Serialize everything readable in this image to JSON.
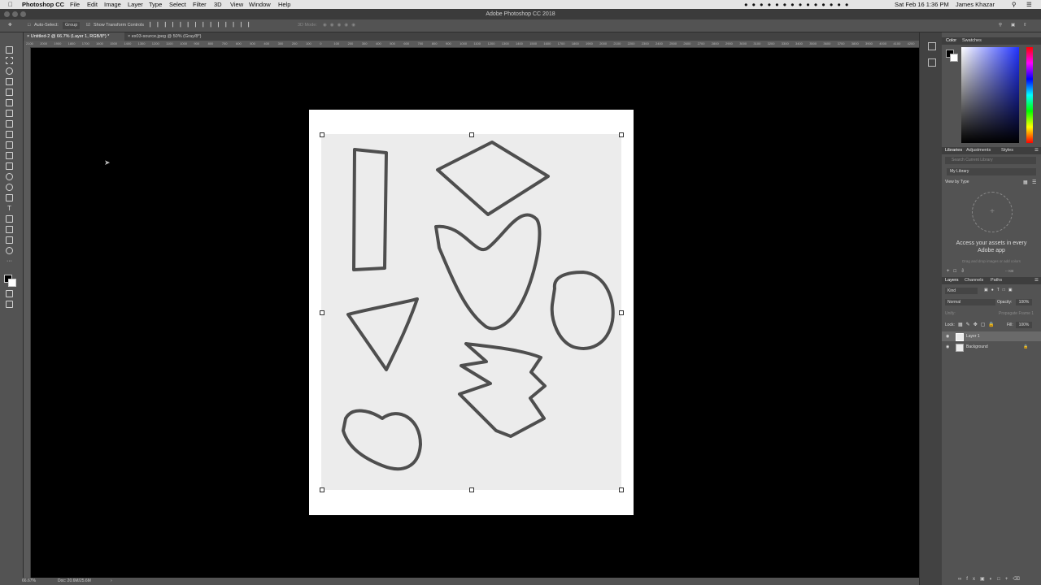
{
  "menubar": {
    "app": "Photoshop CC",
    "items": [
      "File",
      "Edit",
      "Image",
      "Layer",
      "Type",
      "Select",
      "Filter",
      "3D",
      "View",
      "Window",
      "Help"
    ],
    "datetime": "Sat Feb 16  1:36 PM",
    "user": "James Khazar"
  },
  "window": {
    "title": "Adobe Photoshop CC 2018"
  },
  "options": {
    "auto_select": "Auto-Select:",
    "group": "Group",
    "show_transform": "Show Transform Controls",
    "mode_3d": "3D Mode:"
  },
  "tabs": [
    {
      "label": "Untitled-2 @ 66.7% (Layer 1, RGB/8*) *"
    },
    {
      "label": "ex03-source.jpeg @ 50% (Gray/8*)"
    }
  ],
  "ruler": {
    "ticks": [
      "2100",
      "2000",
      "1900",
      "1800",
      "1700",
      "1600",
      "1500",
      "1400",
      "1300",
      "1200",
      "1100",
      "1000",
      "900",
      "800",
      "700",
      "600",
      "500",
      "400",
      "300",
      "200",
      "100",
      "0",
      "100",
      "200",
      "300",
      "400",
      "500",
      "600",
      "700",
      "800",
      "900",
      "1000",
      "1100",
      "1200",
      "1300",
      "1400",
      "1500",
      "1600",
      "1700",
      "1800",
      "1900",
      "2000",
      "2100",
      "2200",
      "2300",
      "2400",
      "2500",
      "2600",
      "2700",
      "2800",
      "2900",
      "3000",
      "3100",
      "3200",
      "3300",
      "3400",
      "3500",
      "3600",
      "3700",
      "3800",
      "3900",
      "4000",
      "4100",
      "4200"
    ]
  },
  "status": {
    "zoom": "66.67%",
    "doc": "Doc: 20.6M/25.6M"
  },
  "color_panel": {
    "tabs": [
      "Color",
      "Swatches"
    ]
  },
  "libraries": {
    "tabs": [
      "Libraries",
      "Adjustments",
      "Styles"
    ],
    "search_placeholder": "Search Current Library",
    "library": "My Library",
    "view_by": "View by Type",
    "empty_title": "Access your assets in every Adobe app",
    "empty_hint": "Drag and drop images or add colors",
    "size": "-- KB"
  },
  "layers": {
    "tabs": [
      "Layers",
      "Channels",
      "Paths"
    ],
    "kind": "Kind",
    "blend": "Normal",
    "opacity_label": "Opacity:",
    "opacity": "100%",
    "unify": "Unify:",
    "propagate": "Propagate Frame 1",
    "lock": "Lock:",
    "fill_label": "Fill:",
    "fill": "100%",
    "rows": [
      {
        "name": "Layer 1",
        "selected": true
      },
      {
        "name": "Background",
        "selected": false
      }
    ]
  }
}
